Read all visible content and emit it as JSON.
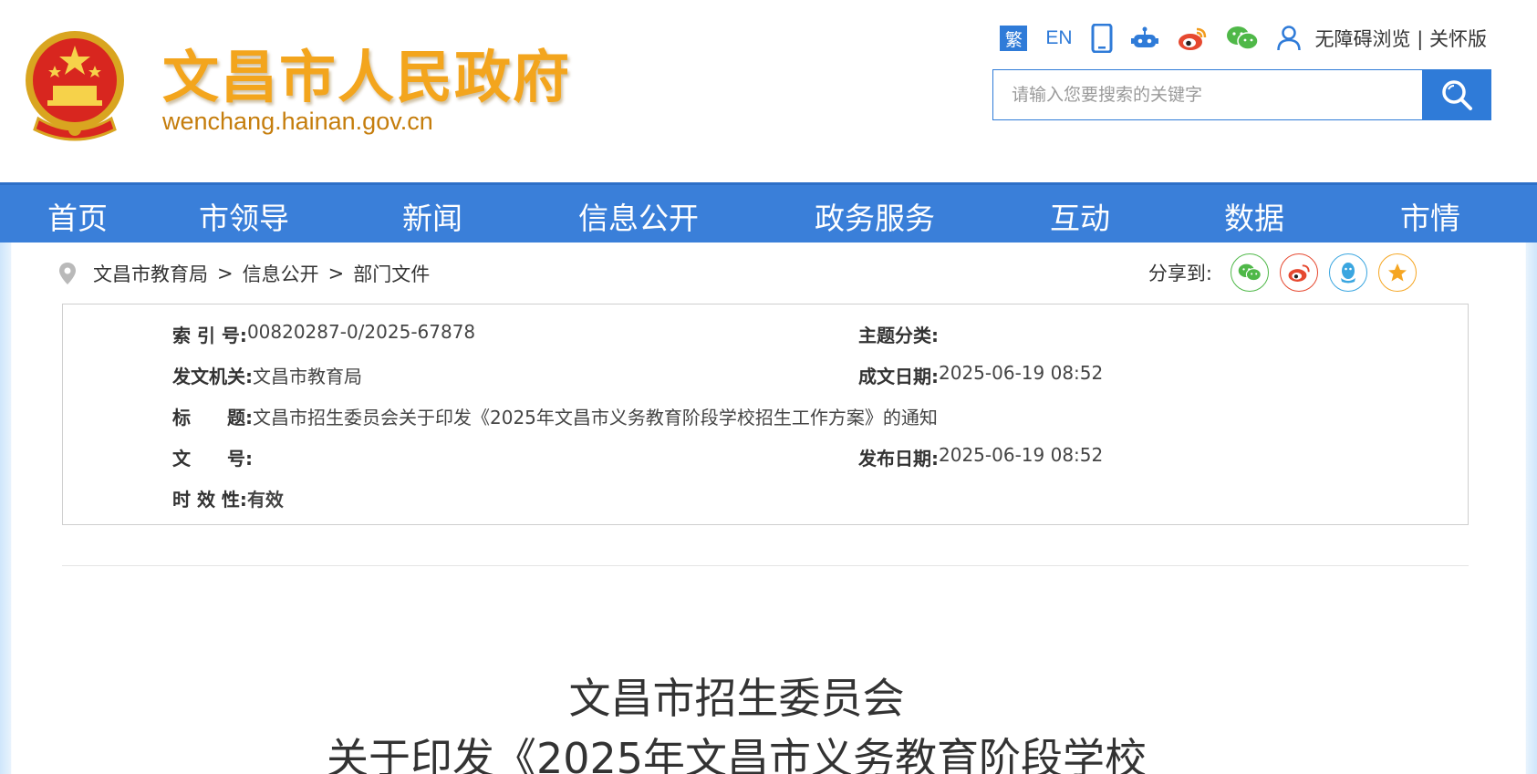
{
  "header": {
    "site_title": "文昌市人民政府",
    "site_domain": "wenchang.hainan.gov.cn",
    "toolbar": {
      "traditional": "繁",
      "english": "EN",
      "accessibility": "无障碍浏览",
      "separator": "|",
      "care_version": "关怀版"
    },
    "search": {
      "placeholder": "请输入您要搜索的关键字"
    }
  },
  "nav": {
    "items": [
      "首页",
      "市领导",
      "新闻",
      "信息公开",
      "政务服务",
      "互动",
      "数据",
      "市情"
    ]
  },
  "breadcrumb": {
    "items": [
      "文昌市教育局",
      "信息公开",
      "部门文件"
    ],
    "separator": ">"
  },
  "share": {
    "label": "分享到:"
  },
  "meta": {
    "index_label": "索 引 号:",
    "index_value": "00820287-0/2025-67878",
    "topic_label": "主题分类:",
    "topic_value": "",
    "issuer_label": "发文机关:",
    "issuer_value": "文昌市教育局",
    "written_date_label": "成文日期:",
    "written_date_value": "2025-06-19 08:52",
    "title_label": "标　　题:",
    "title_value": "文昌市招生委员会关于印发《2025年文昌市义务教育阶段学校招生工作方案》的通知",
    "doc_no_label": "文　　号:",
    "doc_no_value": "",
    "publish_date_label": "发布日期:",
    "publish_date_value": "2025-06-19 08:52",
    "validity_label": "时 效 性:",
    "validity_value": "有效"
  },
  "document": {
    "title_line1": "文昌市招生委员会",
    "title_line2": "关于印发《2025年文昌市义务教育阶段学校"
  },
  "colors": {
    "primary_blue": "#3a7fd9",
    "title_orange": "#f3a51d",
    "wechat_green": "#4fb848",
    "weibo_red": "#e6482f",
    "qq_blue": "#3aa6e0",
    "fav_orange": "#f5a623"
  },
  "icons": [
    "emblem-icon",
    "mobile-icon",
    "robot-icon",
    "weibo-icon",
    "wechat-icon",
    "user-icon",
    "search-icon",
    "location-icon",
    "share-wechat-icon",
    "share-weibo-icon",
    "share-qq-icon",
    "share-favorite-icon"
  ]
}
